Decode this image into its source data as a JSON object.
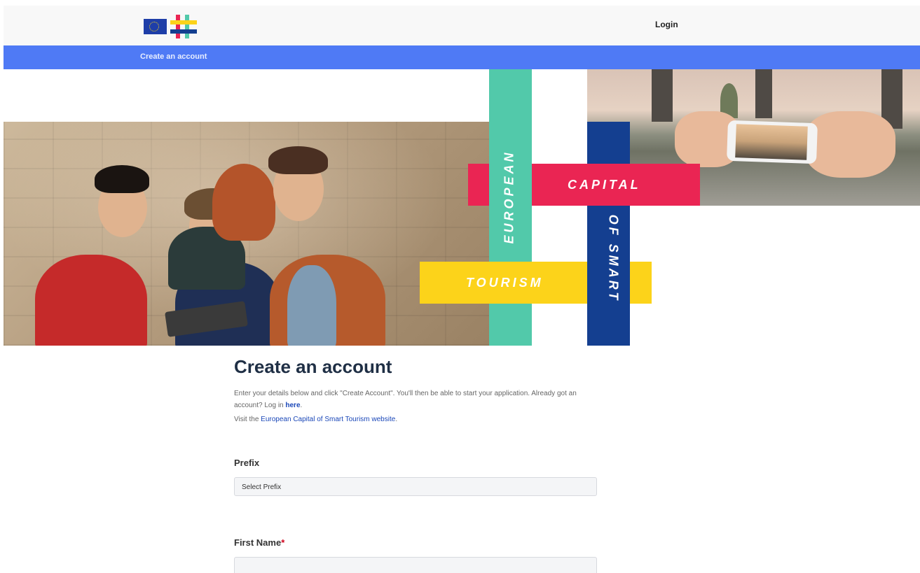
{
  "header": {
    "login_label": "Login",
    "logo_icons": [
      "eu-flag-icon",
      "hashtag-logo-icon"
    ]
  },
  "nav": {
    "items": [
      {
        "label": "Create an account"
      }
    ]
  },
  "banner": {
    "words": {
      "european": "EUROPEAN",
      "capital": "CAPITAL",
      "of_smart": "OF SMART",
      "tourism": "TOURISM"
    },
    "colors": {
      "green": "#52c9aa",
      "red": "#ea2553",
      "blue": "#143f90",
      "yellow": "#fcd31a"
    }
  },
  "main": {
    "title": "Create an account",
    "intro_text": "Enter your details below and click \"Create Account\". You'll then be able to start your application. Already got an account? Log in ",
    "intro_link": "here",
    "intro_end": ".",
    "visit_prefix": "Visit the ",
    "visit_link": "European Capital of Smart Tourism website",
    "visit_end": "."
  },
  "form": {
    "prefix": {
      "label": "Prefix",
      "selected": "Select Prefix"
    },
    "first_name": {
      "label": "First Name",
      "required_mark": "*",
      "value": ""
    }
  },
  "colors": {
    "nav_blue": "#4f7af5",
    "title": "#1f2f45",
    "link": "#1a47b8",
    "required": "#d0021b"
  }
}
